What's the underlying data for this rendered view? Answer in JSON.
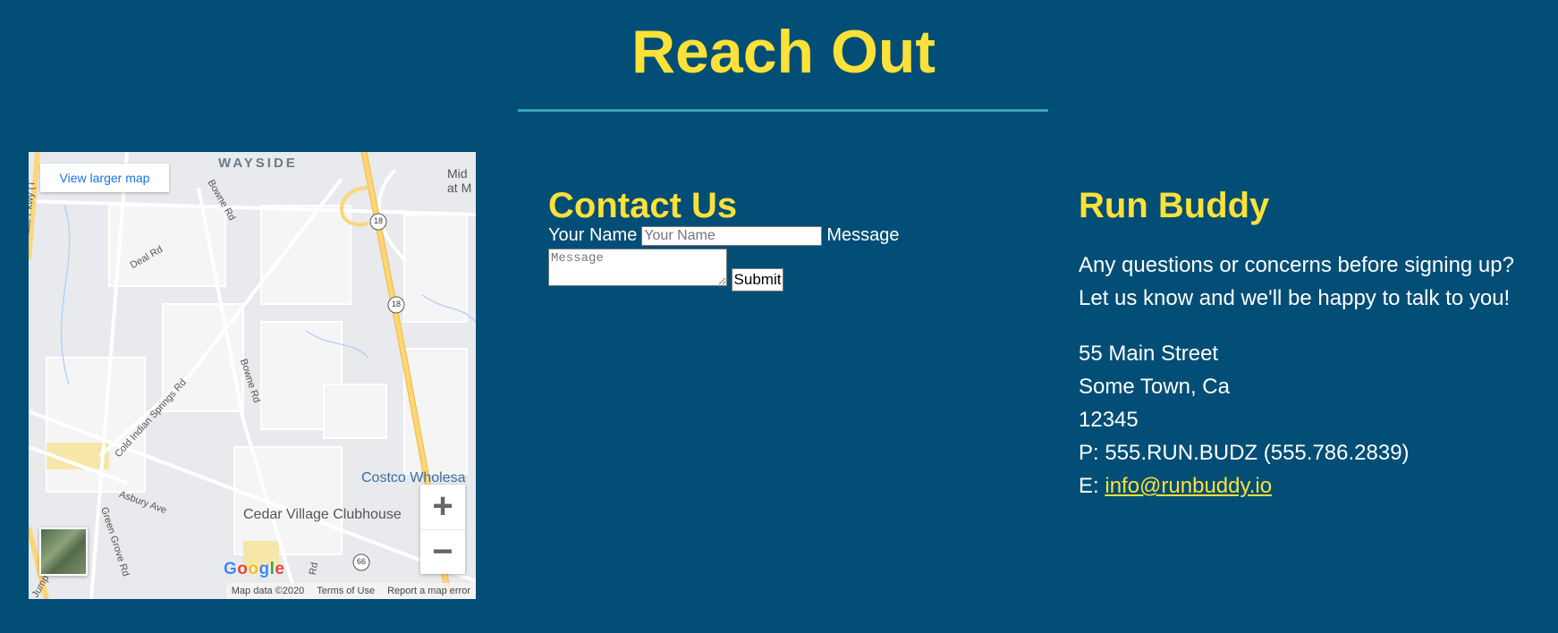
{
  "page_title": "Reach Out",
  "map": {
    "view_larger_label": "View larger map",
    "zoom_in_label": "+",
    "zoom_out_label": "−",
    "logo": [
      "G",
      "o",
      "o",
      "g",
      "l",
      "e"
    ],
    "footer": [
      "Map data ©2020",
      "Terms of Use",
      "Report a map error"
    ],
    "places": [
      "WAYSIDE",
      "Costco Wholesa",
      "Cedar Village Clubhouse",
      "Mid at M"
    ],
    "streets": [
      "Bowne Rd",
      "Deal Rd",
      "Bowne Rd",
      "Cold Indian Springs Rd",
      "Asbury Ave",
      "Green Grove Rd",
      "State Pkwy (T",
      "Jump",
      "Rd"
    ],
    "route_shields": [
      "18",
      "18",
      "66"
    ]
  },
  "contact": {
    "heading": "Contact Us",
    "name_label": "Your Name",
    "name_placeholder": "Your Name",
    "message_label": "Message",
    "message_placeholder": "Message",
    "submit_label": "Submit"
  },
  "run_buddy": {
    "heading": "Run Buddy",
    "intro_line1": "Any questions or concerns before signing up?",
    "intro_line2": "Let us know and we'll be happy to talk to you!",
    "address_line1": "55 Main Street",
    "address_line2": "Some Town, Ca",
    "zip": "12345",
    "phone_prefix": "P:",
    "phone": "555.RUN.BUDZ (555.786.2839)",
    "email_prefix": "E:",
    "email": "info@runbuddy.io"
  },
  "colors": {
    "background": "#024e76",
    "accent": "#fce138",
    "rule": "#39a6b2"
  }
}
